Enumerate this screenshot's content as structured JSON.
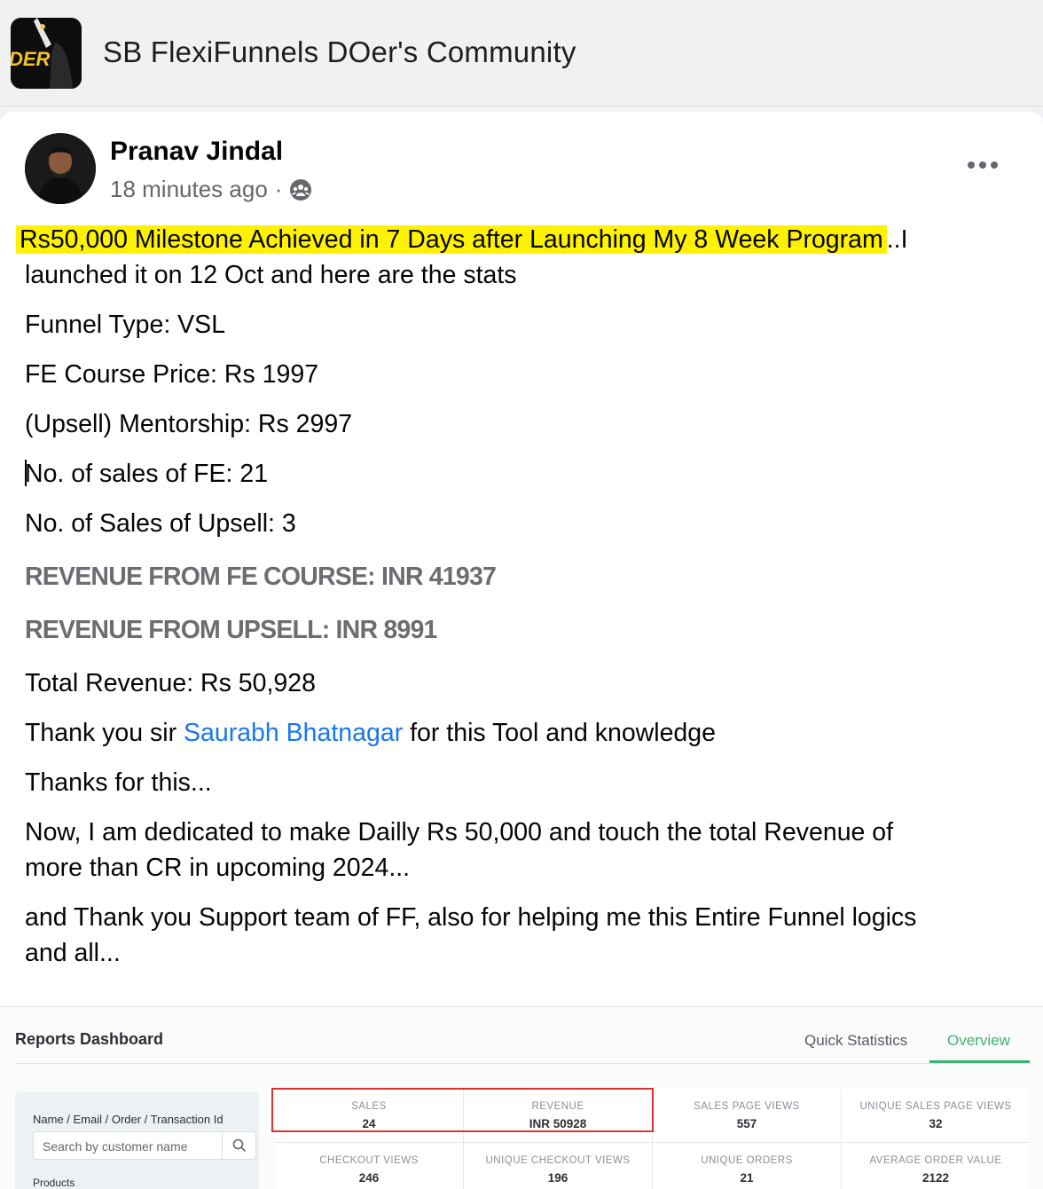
{
  "group": {
    "title": "SB FlexiFunnels DOer's Community",
    "avatar_text": "DER"
  },
  "post": {
    "author": "Pranav Jindal",
    "time": "18 minutes ago",
    "privacy_icon": "group-icon",
    "more_icon": "more-horizontal-icon",
    "headline": "Rs50,000 Milestone Achieved in 7 Days after Launching My 8 Week Program",
    "headline_suffix": "..I",
    "line2": "launched it on 12 Oct and here are the stats",
    "funnel_type": "Funnel Type: VSL",
    "fe_price": "FE Course Price: Rs 1997",
    "upsell_price": "(Upsell) Mentorship: Rs 2997",
    "fe_sales": "No. of sales of FE: 21",
    "upsell_sales": "No. of Sales of Upsell: 3",
    "revenue_fe": "REVENUE FROM FE COURSE: INR 41937",
    "revenue_upsell": "REVENUE FROM UPSELL: INR 8991",
    "total_revenue": "Total Revenue: Rs 50,928",
    "thanks_prefix": "Thank you sir ",
    "mention": "Saurabh Bhatnagar",
    "thanks_suffix": " for this Tool and knowledge",
    "thanks_short": "Thanks for this...",
    "goal_line1": "Now, I am dedicated to make Dailly Rs 50,000 and touch the total Revenue of",
    "goal_line2": "more than CR in upcoming 2024...",
    "support_line1": "and Thank you Support team of FF, also for helping me this Entire Funnel logics",
    "support_line2": "and all..."
  },
  "dashboard": {
    "title": "Reports Dashboard",
    "tabs": [
      "Quick Statistics",
      "Overview"
    ],
    "active_tab": "Overview",
    "filter_label": "Name / Email / Order / Transaction Id",
    "search_placeholder": "Search by customer name",
    "products_label": "Products",
    "highlight_color": "#e03131",
    "accent_color": "#3cb371",
    "stats": [
      {
        "label": "SALES",
        "value": "24"
      },
      {
        "label": "REVENUE",
        "value": "INR 50928"
      },
      {
        "label": "SALES PAGE VIEWS",
        "value": "557"
      },
      {
        "label": "UNIQUE SALES PAGE VIEWS",
        "value": "32"
      },
      {
        "label": "CHECKOUT VIEWS",
        "value": "246"
      },
      {
        "label": "UNIQUE CHECKOUT VIEWS",
        "value": "196"
      },
      {
        "label": "UNIQUE ORDERS",
        "value": "21"
      },
      {
        "label": "AVERAGE ORDER VALUE",
        "value": "2122"
      }
    ]
  }
}
